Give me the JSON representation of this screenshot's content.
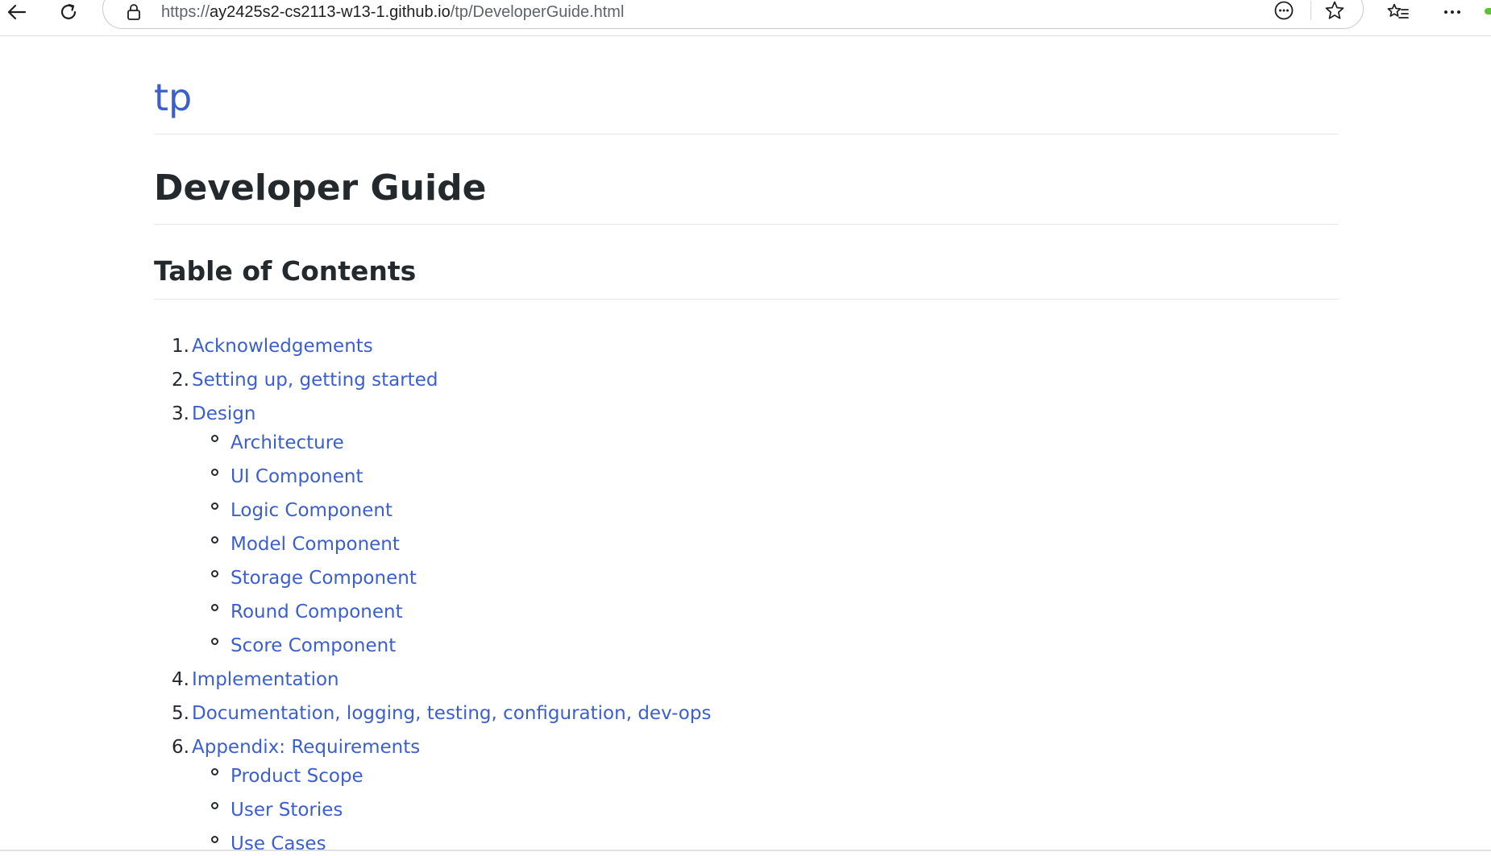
{
  "browser": {
    "url_prefix": "https://",
    "url_host": "ay2425s2-cs2113-w13-1.github.io",
    "url_path": "/tp/DeveloperGuide.html",
    "icons": {
      "back": "back-arrow-icon",
      "refresh": "refresh-icon",
      "lock": "lock-icon",
      "reader": "reading-mode-icon",
      "favorite": "star-icon",
      "favorites": "favorites-list-icon",
      "menu": "more-icon"
    }
  },
  "page": {
    "site_title": "tp",
    "heading": "Developer Guide",
    "toc_heading": "Table of Contents",
    "toc": [
      {
        "num": "1.",
        "label": "Acknowledgements"
      },
      {
        "num": "2.",
        "label": "Setting up, getting started"
      },
      {
        "num": "3.",
        "label": "Design",
        "children": [
          "Architecture",
          "UI Component",
          "Logic Component",
          "Model Component",
          "Storage Component",
          "Round Component",
          "Score Component"
        ]
      },
      {
        "num": "4.",
        "label": "Implementation"
      },
      {
        "num": "5.",
        "label": "Documentation, logging, testing, configuration, dev-ops"
      },
      {
        "num": "6.",
        "label": "Appendix: Requirements",
        "children": [
          "Product Scope",
          "User Stories",
          "Use Cases"
        ]
      }
    ]
  },
  "colors": {
    "link": "#3b5fcc",
    "text": "#24292e"
  }
}
